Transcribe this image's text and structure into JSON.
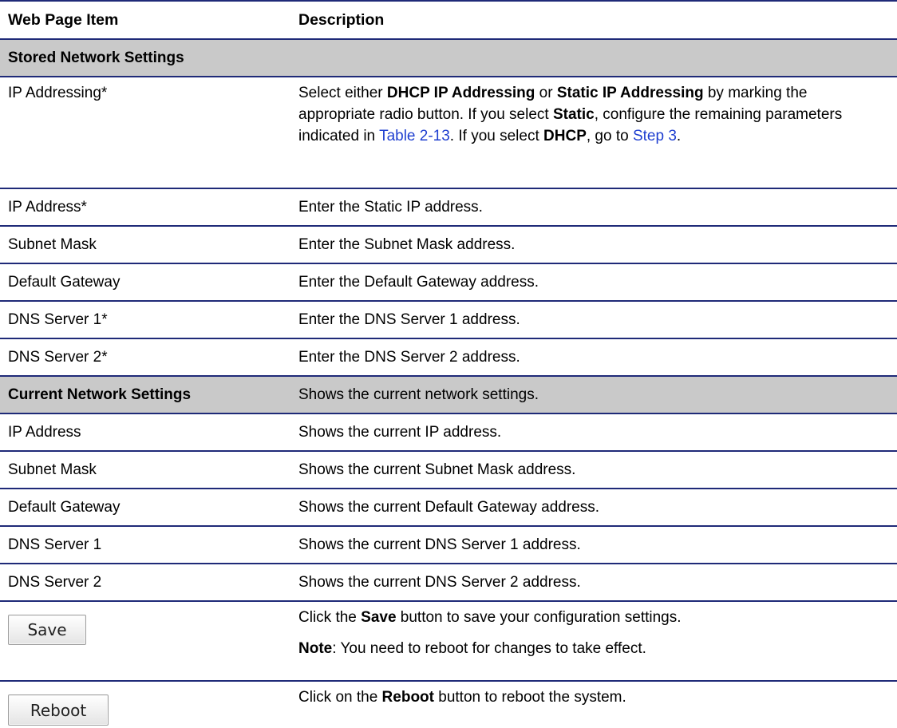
{
  "header": {
    "col1": "Web Page Item",
    "col2": "Description"
  },
  "stored_section": {
    "title": "Stored Network Settings"
  },
  "ip_addressing": {
    "label": "IP Addressing*",
    "d1": "Select either ",
    "b1": "DHCP IP Addressing",
    "d2": " or ",
    "b2": "Static IP Addressing",
    "d3": " by marking the appropriate radio button. If you select ",
    "b3": "Static",
    "d4": ", configure the remaining parameters indicated in ",
    "link1": "Table 2-13",
    "d5": ". If you select ",
    "b4": "DHCP",
    "d6": ", go to ",
    "link2": "Step 3",
    "d7": "."
  },
  "stored_rows": [
    {
      "item": "IP Address*",
      "desc": "Enter the Static IP address."
    },
    {
      "item": "Subnet Mask",
      "desc": "Enter the Subnet Mask address."
    },
    {
      "item": "Default Gateway",
      "desc": "Enter the Default Gateway address."
    },
    {
      "item": "DNS Server 1*",
      "desc": "Enter the DNS Server 1 address."
    },
    {
      "item": "DNS Server 2*",
      "desc": "Enter the DNS Server 2 address."
    }
  ],
  "current_section": {
    "title": "Current Network Settings",
    "desc": "Shows the current network settings."
  },
  "current_rows": [
    {
      "item": "IP Address",
      "desc": "Shows the current IP address."
    },
    {
      "item": "Subnet Mask",
      "desc": "Shows the current Subnet Mask address."
    },
    {
      "item": "Default Gateway",
      "desc": "Shows the current Default Gateway address."
    },
    {
      "item": "DNS Server 1",
      "desc": "Shows the current DNS Server 1 address."
    },
    {
      "item": "DNS Server 2",
      "desc": "Shows the current DNS Server 2 address."
    }
  ],
  "save": {
    "button_label": "Save",
    "d1": "Click the ",
    "b1": "Save",
    "d2": " button to save your configuration settings.",
    "note_label": "Note",
    "note_text": ": You need to reboot for changes to take effect."
  },
  "reboot": {
    "button_label": "Reboot",
    "d1": "Click on the ",
    "b1": "Reboot",
    "d2": " button to reboot the system."
  }
}
